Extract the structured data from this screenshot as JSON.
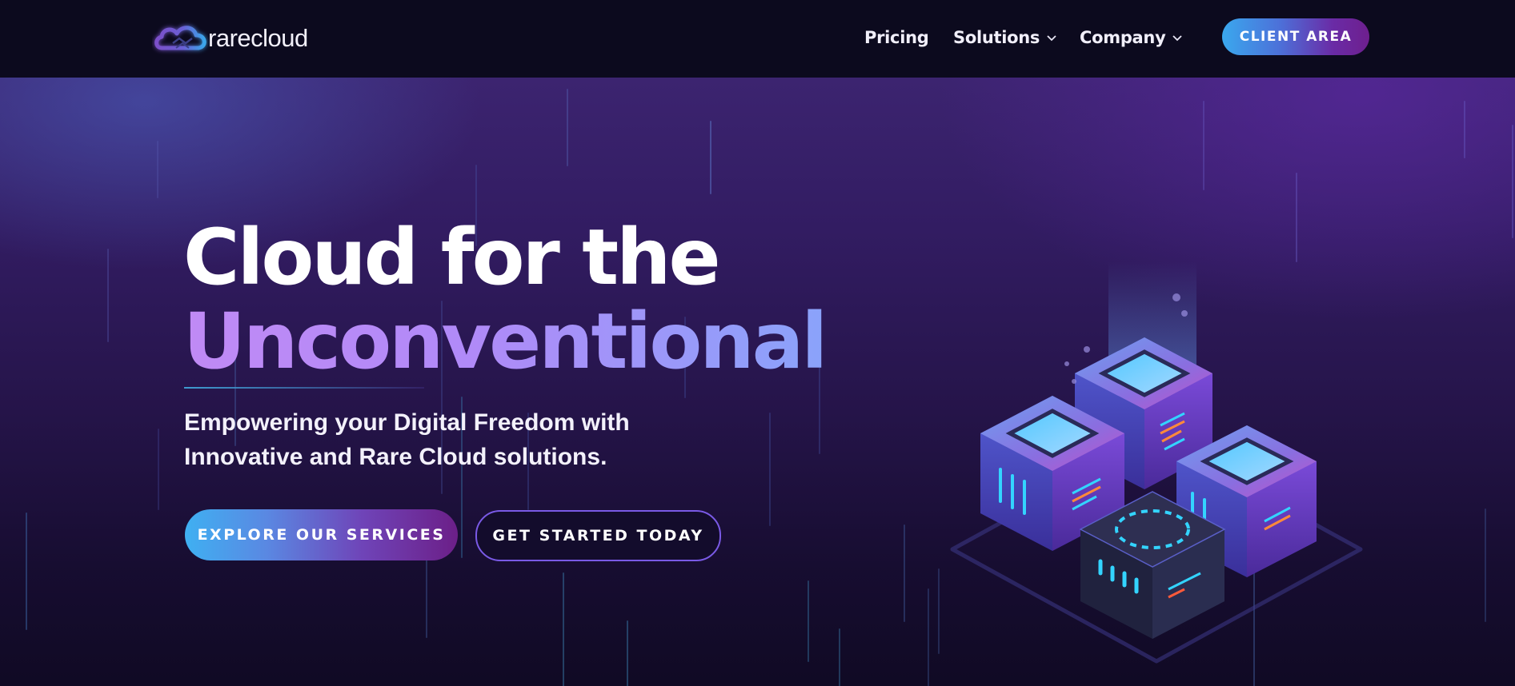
{
  "brand": {
    "name": "rarecloud",
    "logo_icon": "cloud-logo-icon"
  },
  "nav": {
    "items": [
      {
        "label": "Pricing",
        "has_dropdown": false
      },
      {
        "label": "Solutions",
        "has_dropdown": true
      },
      {
        "label": "Company",
        "has_dropdown": true
      }
    ],
    "cta_label": "CLIENT AREA"
  },
  "hero": {
    "title_line1": "Cloud for the",
    "title_line2": "Unconventional",
    "subtitle": "Empowering your Digital Freedom with Innovative and Rare Cloud solutions.",
    "primary_button": "EXPLORE OUR SERVICES",
    "secondary_button": "GET STARTED TODAY",
    "illustration": "isometric-server-cubes-illustration"
  },
  "colors": {
    "nav_bg": "#0c0a1e",
    "accent_blue": "#3fb0f2",
    "accent_purple": "#6c1f88",
    "headline_gradient_start": "#c08af5",
    "headline_gradient_end": "#8aa3fa",
    "secondary_border": "#7a5ae6"
  }
}
